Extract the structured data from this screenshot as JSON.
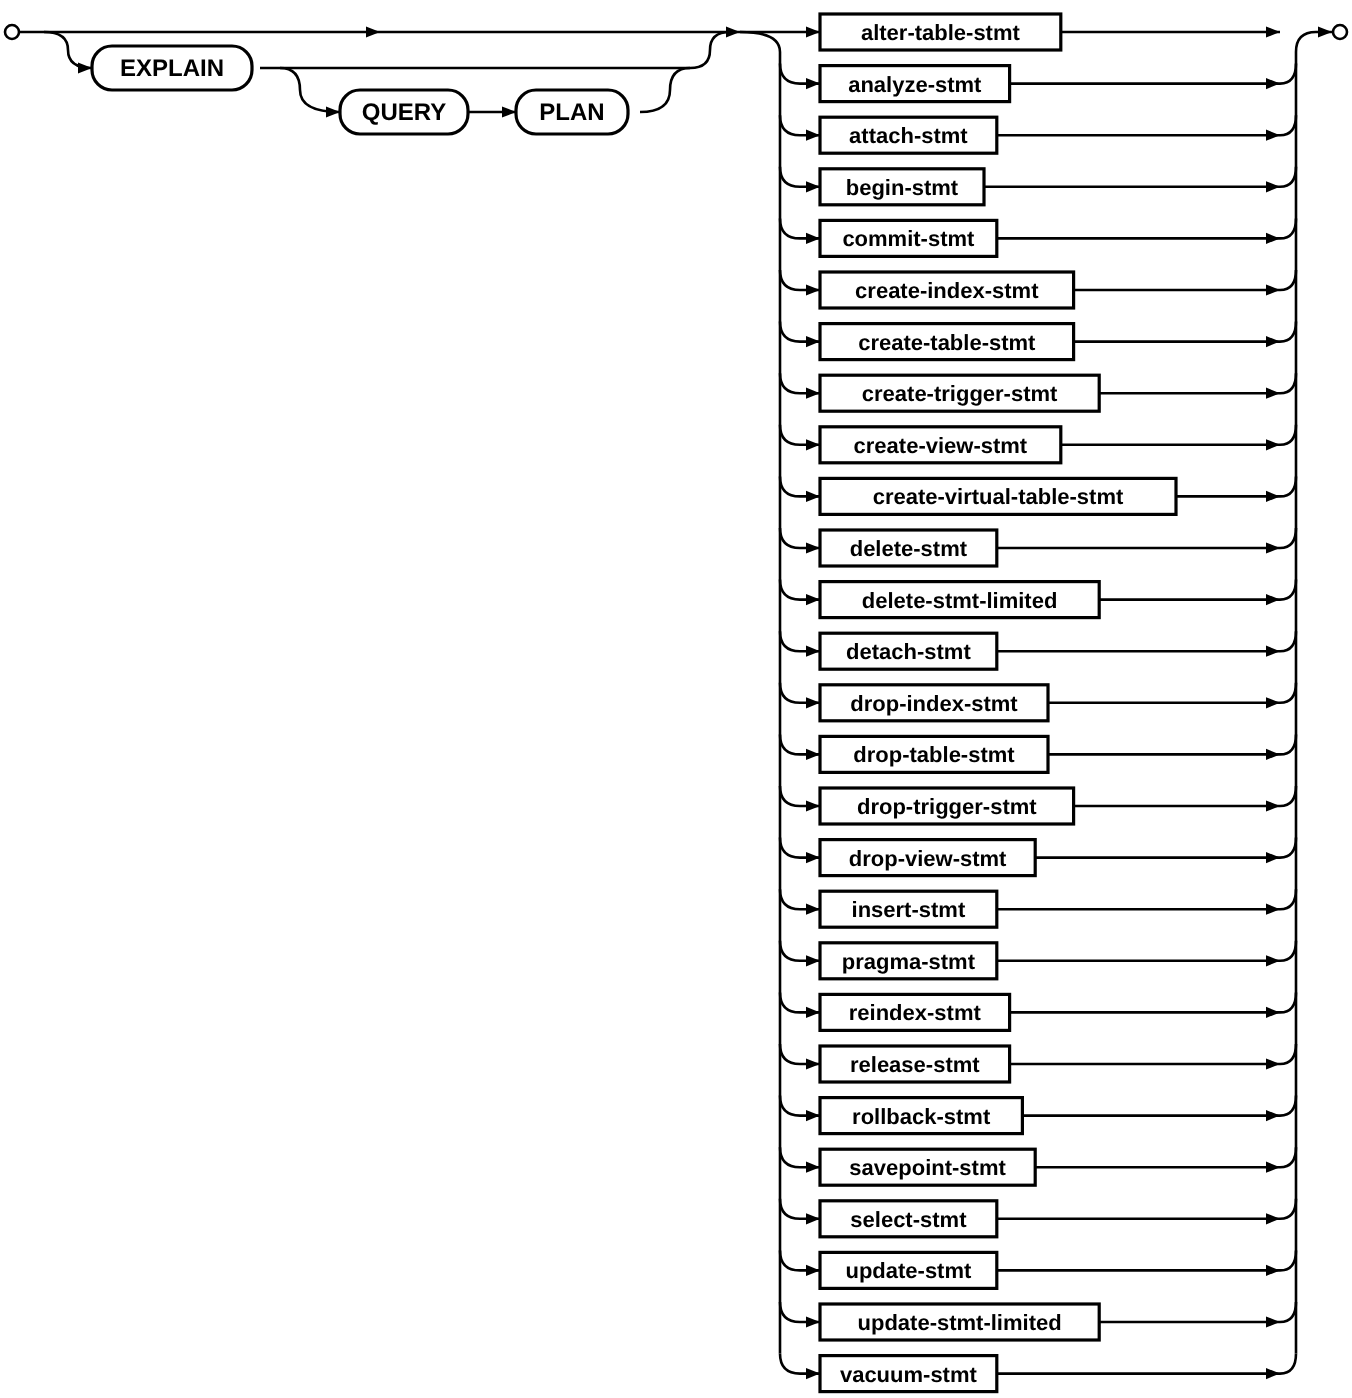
{
  "prefix": {
    "keywords": [
      "EXPLAIN",
      "QUERY",
      "PLAN"
    ]
  },
  "statements": [
    "alter-table-stmt",
    "analyze-stmt",
    "attach-stmt",
    "begin-stmt",
    "commit-stmt",
    "create-index-stmt",
    "create-table-stmt",
    "create-trigger-stmt",
    "create-view-stmt",
    "create-virtual-table-stmt",
    "delete-stmt",
    "delete-stmt-limited",
    "detach-stmt",
    "drop-index-stmt",
    "drop-table-stmt",
    "drop-trigger-stmt",
    "drop-view-stmt",
    "insert-stmt",
    "pragma-stmt",
    "reindex-stmt",
    "release-stmt",
    "rollback-stmt",
    "savepoint-stmt",
    "select-stmt",
    "update-stmt",
    "update-stmt-limited",
    "vacuum-stmt"
  ]
}
